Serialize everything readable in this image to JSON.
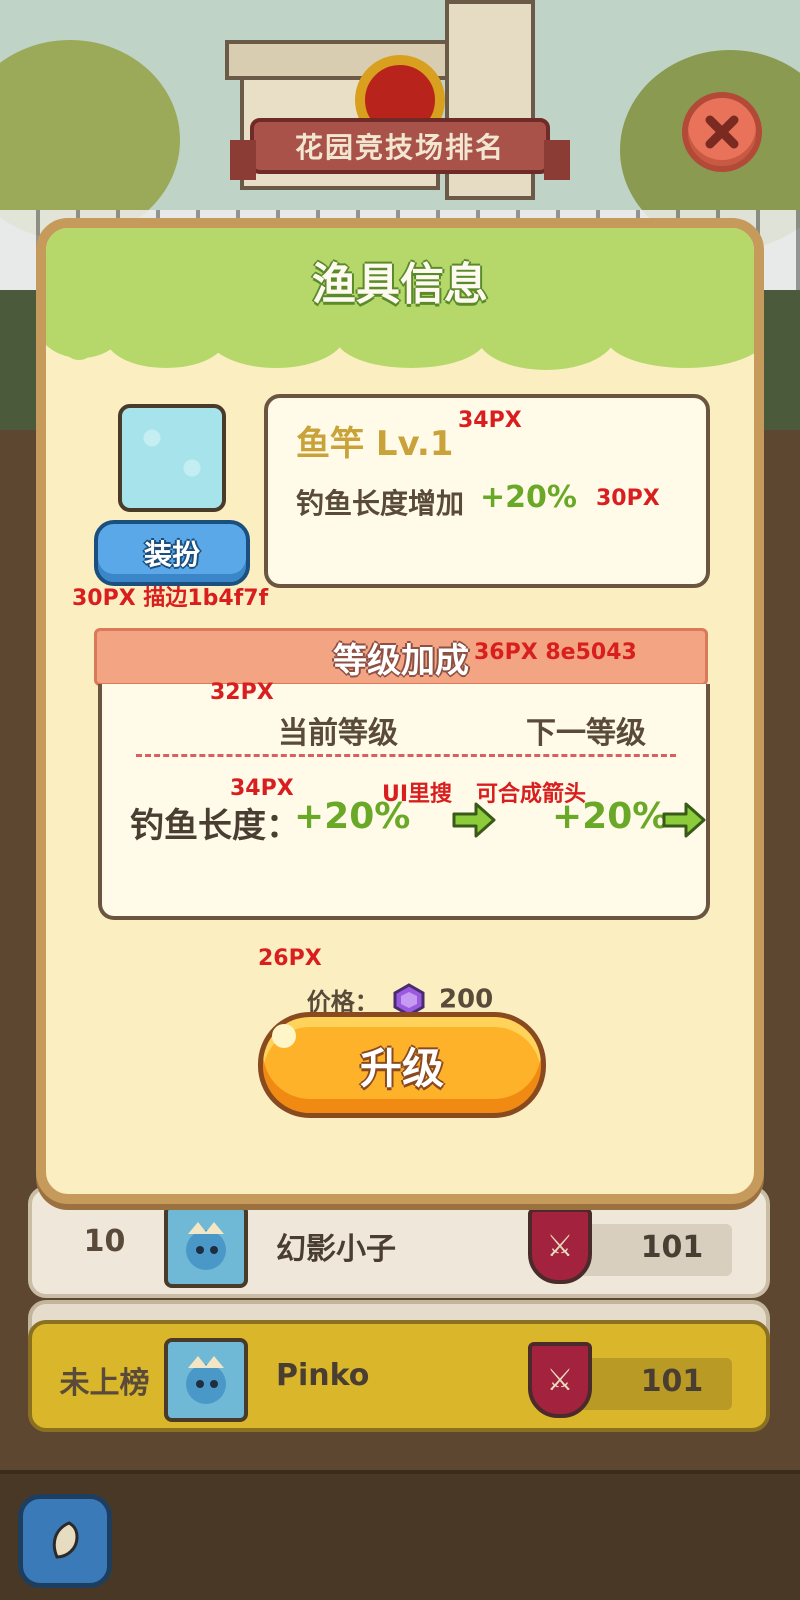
{
  "header": {
    "title": "花园竞技场排名"
  },
  "modal": {
    "title": "渔具信息",
    "item": {
      "name": "鱼竿 Lv.1",
      "effect_label": "钓鱼长度增加",
      "effect_value": "+20%"
    },
    "equip_button": "装扮",
    "level_section": {
      "title": "等级加成",
      "current_header": "当前等级",
      "next_header": "下一等级",
      "stat_label": "钓鱼长度：",
      "current_value": "+20%",
      "next_value": "+20%"
    },
    "price": {
      "label": "价格：",
      "value": "200"
    },
    "upgrade_button": "升级"
  },
  "annotations": {
    "item_name_size": "34PX",
    "effect_size": "30PX",
    "equip_note": "30PX 描边1b4f7f",
    "ribbon_note": "36PX 8e5043",
    "header_size": "32PX",
    "stat_size": "34PX",
    "arrow_note_1": "UI里搜",
    "arrow_note_2": "可合成箭头",
    "price_size": "26PX"
  },
  "leaderboard": {
    "rows": [
      {
        "rank": "10",
        "name": "幻影小子",
        "score": "101"
      },
      {
        "rank": "未上榜",
        "name": "Pinko",
        "score": "101"
      }
    ]
  },
  "colors": {
    "equip_stroke": "#1b4f7f",
    "ribbon_stroke": "#8e5043",
    "accent_green": "#6aa828",
    "upgrade_orange": "#fdb22a"
  },
  "icons": {
    "close": "close-icon",
    "gem": "purple-gem-icon",
    "arrow": "green-arrow-icon",
    "home": "home-icon"
  }
}
